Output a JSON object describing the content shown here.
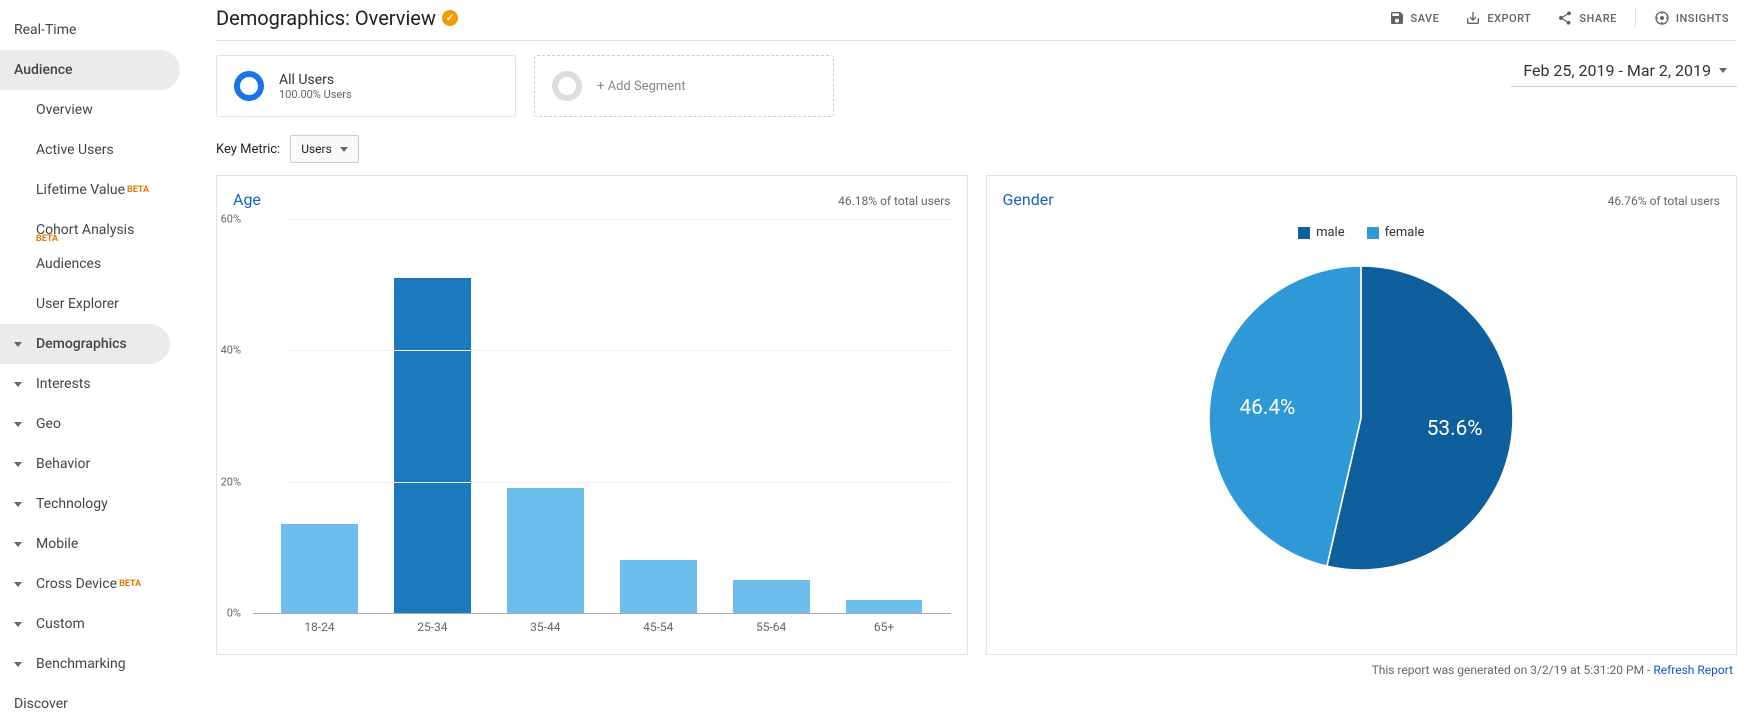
{
  "sidebar": {
    "real_time": "Real-Time",
    "audience": "Audience",
    "overview": "Overview",
    "active_users": "Active Users",
    "lifetime_value": "Lifetime Value",
    "cohort_analysis": "Cohort Analysis",
    "audiences": "Audiences",
    "user_explorer": "User Explorer",
    "demographics": "Demographics",
    "interests": "Interests",
    "geo": "Geo",
    "behavior": "Behavior",
    "technology": "Technology",
    "mobile": "Mobile",
    "cross_device": "Cross Device",
    "custom": "Custom",
    "benchmarking": "Benchmarking",
    "discover": "Discover",
    "beta": "BETA"
  },
  "header": {
    "title": "Demographics: Overview",
    "save": "SAVE",
    "export": "EXPORT",
    "share": "SHARE",
    "insights": "INSIGHTS"
  },
  "segments": {
    "all_users": "All Users",
    "all_users_sub": "100.00% Users",
    "add_segment": "+ Add Segment"
  },
  "date_range": "Feb 25, 2019 - Mar 2, 2019",
  "key_metric": {
    "label": "Key Metric:",
    "value": "Users"
  },
  "age_panel": {
    "title": "Age",
    "subtitle": "46.18% of total users"
  },
  "gender_panel": {
    "title": "Gender",
    "subtitle": "46.76% of total users",
    "legend_male": "male",
    "legend_female": "female",
    "male_pct": "53.6%",
    "female_pct": "46.4%"
  },
  "footer": {
    "text": "This report was generated on 3/2/19 at 5:31:20 PM - ",
    "refresh": "Refresh Report"
  },
  "chart_data": [
    {
      "type": "bar",
      "title": "Age",
      "subtitle": "46.18% of total users",
      "categories": [
        "18-24",
        "25-34",
        "35-44",
        "45-54",
        "55-64",
        "65+"
      ],
      "values": [
        13.5,
        51,
        19,
        8,
        5,
        2
      ],
      "highlight_index": 1,
      "ylabel": "",
      "xlabel": "",
      "ylim": [
        0,
        60
      ],
      "yticks": [
        0,
        20,
        40,
        60
      ]
    },
    {
      "type": "pie",
      "title": "Gender",
      "subtitle": "46.76% of total users",
      "series": [
        {
          "name": "male",
          "value": 53.6,
          "color": "#0e5f9c"
        },
        {
          "name": "female",
          "value": 46.4,
          "color": "#2e99d6"
        }
      ]
    }
  ]
}
